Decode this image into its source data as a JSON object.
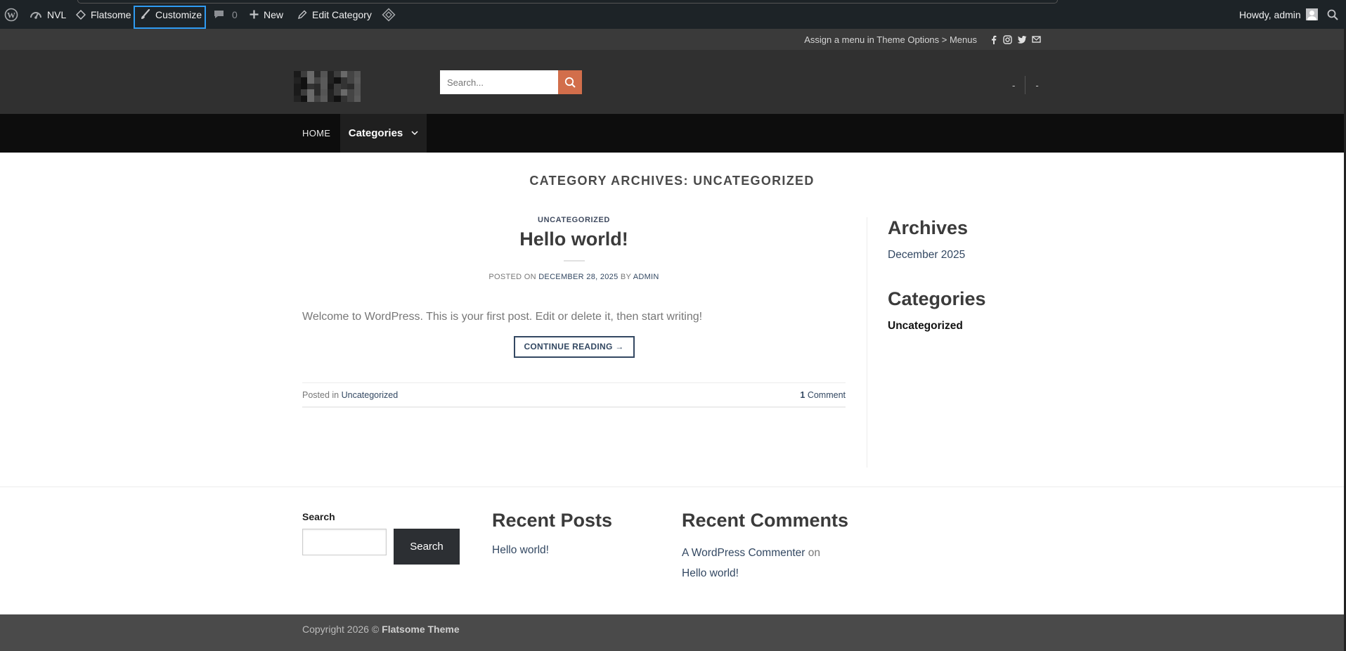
{
  "adminbar": {
    "site_name": "NVL",
    "theme_name": "Flatsome",
    "customize": "Customize",
    "comments_count": "0",
    "new": "New",
    "edit_category": "Edit Category",
    "howdy": "Howdy, admin"
  },
  "topbar": {
    "menu_note": "Assign a menu in Theme Options > Menus",
    "socials": [
      "facebook-icon",
      "instagram-icon",
      "twitter-icon",
      "email-icon"
    ]
  },
  "header": {
    "search_placeholder": "Search...",
    "right_item_1": "-",
    "right_item_2": "-",
    "accent_color": "#d26e4b"
  },
  "nav": {
    "home": "HOME",
    "categories": "Categories"
  },
  "main": {
    "archive_title": "CATEGORY ARCHIVES: UNCATEGORIZED",
    "post": {
      "category": "UNCATEGORIZED",
      "title": "Hello world!",
      "posted_on_label": "POSTED ON",
      "date": "DECEMBER 28, 2025",
      "by_label": "BY",
      "author": "ADMIN",
      "excerpt": "Welcome to WordPress. This is your first post. Edit or delete it, then start writing!",
      "continue": "CONTINUE READING →",
      "posted_in_label": "Posted in",
      "posted_in_value": "Uncategorized",
      "comments_count": "1",
      "comments_label": "Comment"
    },
    "sidebar": {
      "archives_title": "Archives",
      "archives_item": "December 2025",
      "categories_title": "Categories",
      "categories_item": "Uncategorized"
    }
  },
  "footer_widgets": {
    "search_label": "Search",
    "search_button": "Search",
    "recent_posts_title": "Recent Posts",
    "recent_posts_item": "Hello world!",
    "recent_comments_title": "Recent Comments",
    "comment_author": "A WordPress Commenter",
    "comment_on": "on",
    "comment_post": "Hello world!"
  },
  "copyright": {
    "prefix": "Copyright 2026 ©",
    "theme": "Flatsome Theme"
  }
}
